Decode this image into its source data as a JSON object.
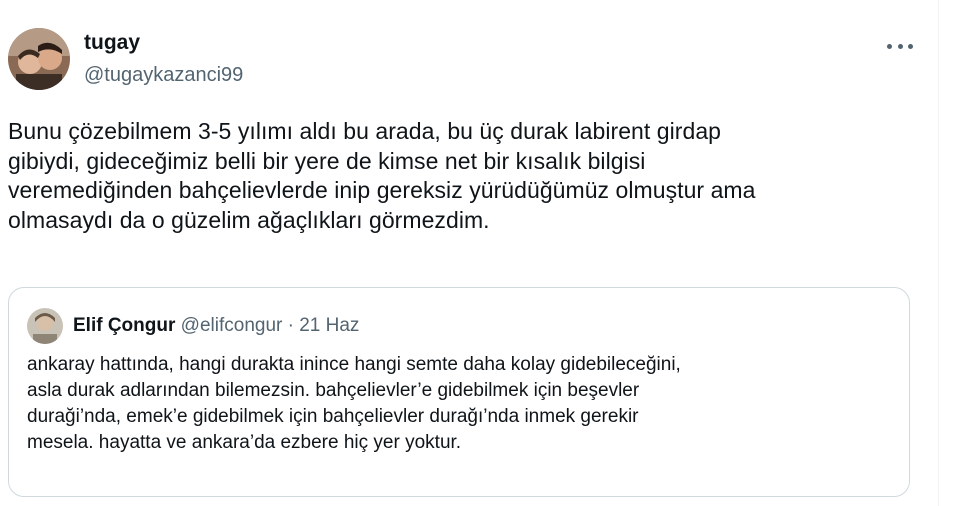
{
  "tweet": {
    "author_name": "tugay",
    "author_handle": "@tugaykazanci99",
    "text": "Bunu çözebilmem 3-5 yılımı aldı bu arada, bu üç durak labirent girdap\ngibiydi, gideceğimiz belli bir yere de kimse net bir kısalık bilgisi\nveremediğinden bahçelievlerde inip gereksiz yürüdüğümüz olmuştur ama\nolmasaydı da o güzelim ağaçlıkları görmezdim.",
    "more_icon": "more-horizontal-icon"
  },
  "quote": {
    "author_name": "Elif Çongur",
    "author_handle": "@elifcongur",
    "separator": "·",
    "date": "21 Haz",
    "text": "ankaray hattında, hangi durakta inince hangi semte daha kolay gidebileceğini,\nasla durak adlarından bilemezsin. bahçelievler’e gidebilmek için beşevler\nduraği’nda, emek’e gidebilmek için bahçelievler durağı’nda inmek gerekir\nmesela. hayatta ve ankara’da ezbere hiç yer yoktur."
  },
  "colors": {
    "text_primary": "#0f1419",
    "text_secondary": "#536471",
    "border": "#cfd9de"
  }
}
